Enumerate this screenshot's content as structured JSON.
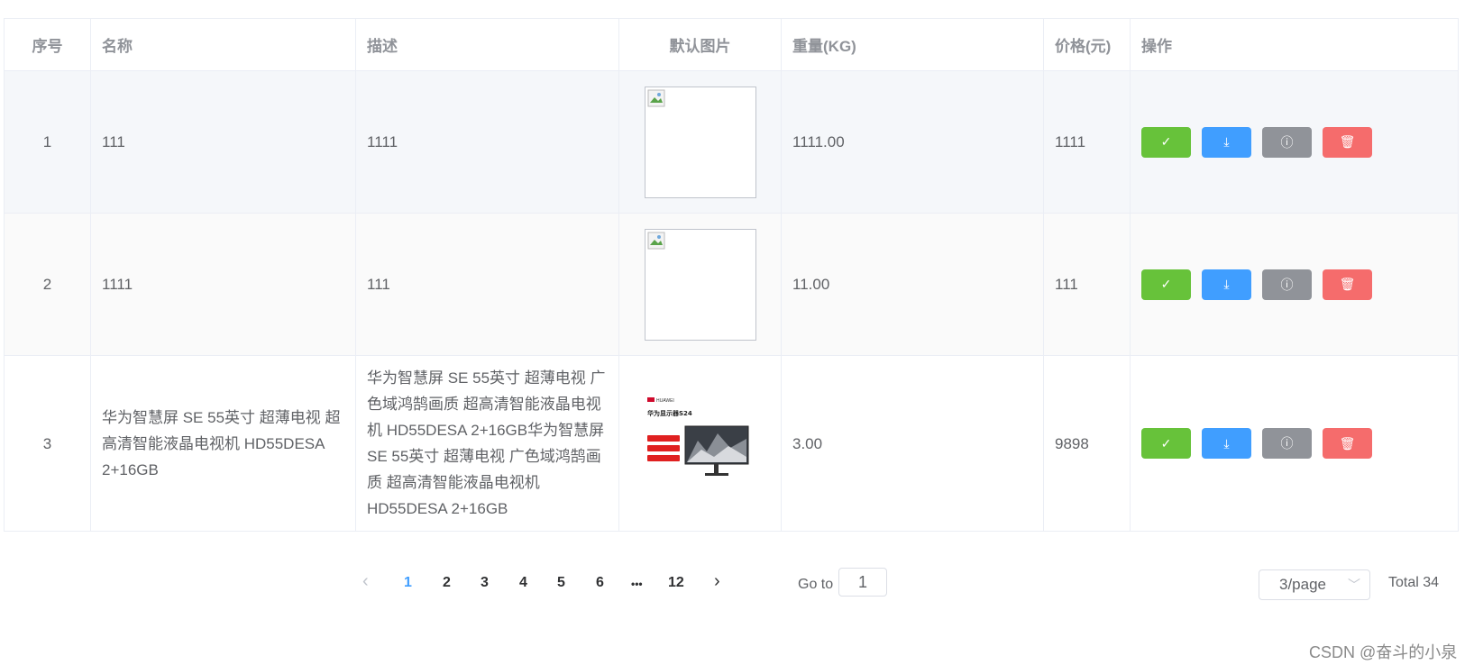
{
  "table": {
    "headers": [
      "序号",
      "名称",
      "描述",
      "默认图片",
      "重量(KG)",
      "价格(元)",
      "操作"
    ],
    "rows": [
      {
        "index": "1",
        "name": "111",
        "desc": "1111",
        "weight": "1111.00",
        "price": "1111",
        "image": "broken"
      },
      {
        "index": "2",
        "name": "1111",
        "desc": "111",
        "weight": "11.00",
        "price": "111",
        "image": "broken"
      },
      {
        "index": "3",
        "name": "华为智慧屏 SE 55英寸 超薄电视 超高清智能液晶电视机 HD55DESA 2+16GB",
        "desc": "华为智慧屏 SE 55英寸 超薄电视 广色域鸿鹄画质 超高清智能液晶电视机 HD55DESA 2+16GB华为智慧屏 SE 55英寸 超薄电视 广色域鸿鹄画质 超高清智能液晶电视机 HD55DESA 2+16GB",
        "weight": "3.00",
        "price": "9898",
        "image": "product"
      }
    ],
    "actions": [
      {
        "name": "check-icon",
        "color": "#67c23a"
      },
      {
        "name": "download-icon",
        "color": "#409eff"
      },
      {
        "name": "info-icon",
        "color": "#909399"
      },
      {
        "name": "delete-icon",
        "color": "#f56c6c"
      }
    ],
    "product_image": {
      "brand": "HUAWEI",
      "title": "华为显示器S24"
    }
  },
  "pagination": {
    "prev": "‹",
    "pages": [
      "1",
      "2",
      "3",
      "4",
      "5",
      "6",
      "•••",
      "12"
    ],
    "current": "1",
    "next": "›",
    "goto_label": "Go to",
    "goto_value": "1",
    "page_size": "3/page",
    "total": "Total 34"
  },
  "watermark": "CSDN @奋斗的小泉"
}
